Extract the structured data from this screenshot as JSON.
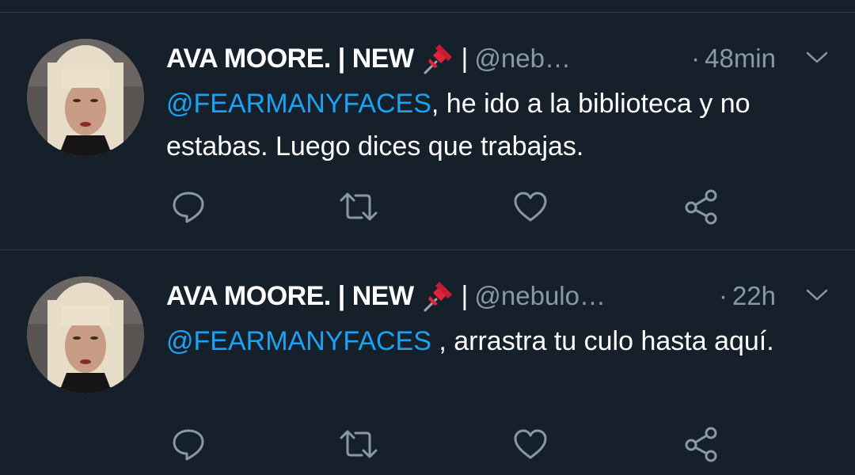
{
  "tweets": [
    {
      "author_name": "AVA MOORE. | NEW",
      "separator": "|",
      "handle": "@neb…",
      "time": "48min",
      "mention": "@FEARMANYFACES",
      "text": ", he ido a la biblioteca y no estabas. Luego dices que trabajas."
    },
    {
      "author_name": "AVA MOORE. | NEW",
      "separator": "|",
      "handle": "@nebulo…",
      "time": "22h",
      "mention": "@FEARMANYFACES",
      "text": " , arrastra tu culo hasta aquí."
    }
  ],
  "colors": {
    "background": "#15202b",
    "accent": "#1da1f2",
    "muted": "#8899a6",
    "divider": "#2f3d4c"
  },
  "icons": {
    "pin": "pushpin-icon",
    "more": "chevron-down-icon",
    "reply": "reply-icon",
    "retweet": "retweet-icon",
    "like": "heart-icon",
    "share": "share-icon"
  }
}
